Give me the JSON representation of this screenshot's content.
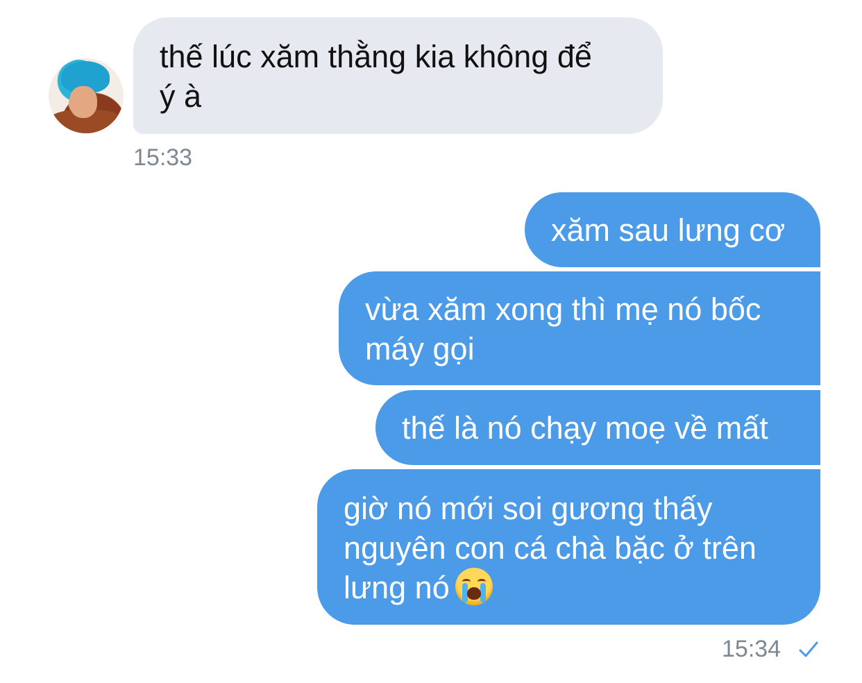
{
  "incoming": {
    "message": {
      "lines": [
        "thế lúc xăm thằng kia không để",
        "ý à"
      ]
    },
    "time": "15:33"
  },
  "outgoing": {
    "messages": [
      {
        "lines": [
          "xăm sau lưng cơ"
        ]
      },
      {
        "lines": [
          "vừa xăm xong thì mẹ nó bốc",
          "máy gọi"
        ]
      },
      {
        "lines": [
          "thế là nó chạy moẹ về mất"
        ]
      },
      {
        "lines": [
          "giờ nó mới soi gương thấy",
          "nguyên con cá chà bặc ở trên",
          "lưng nó"
        ],
        "emoji": "loudly-crying-face-emoji"
      }
    ],
    "time": "15:34",
    "status_icon": "single-check-icon"
  },
  "colors": {
    "incoming_bubble": "#e6e9ef",
    "outgoing_bubble": "#4c9be8",
    "timestamp": "#7d8893",
    "check": "#4c9be8"
  }
}
